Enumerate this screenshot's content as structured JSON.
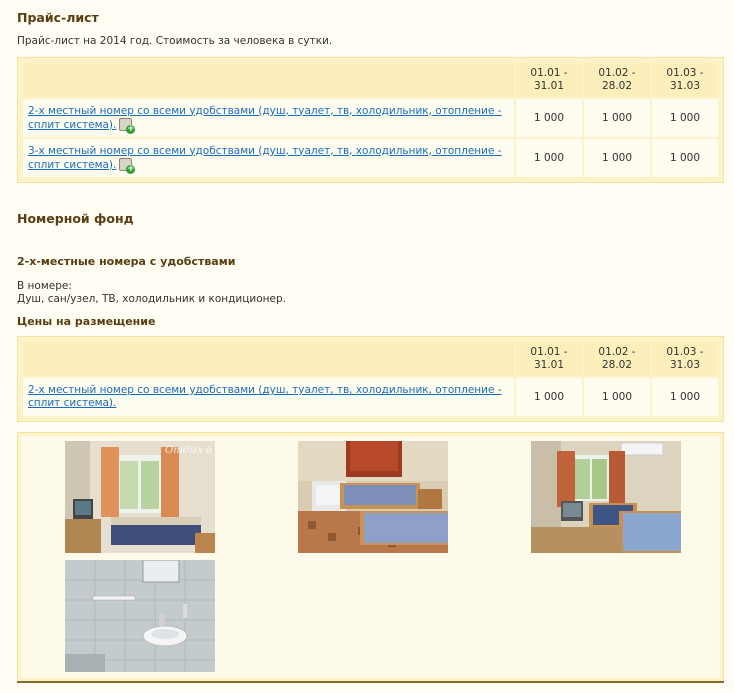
{
  "price_list": {
    "heading": "Прайс-лист",
    "note": "Прайс-лист на 2014 год. Стоимость за человека в сутки.",
    "columns": [
      "01.01 - 31.01",
      "01.02 - 28.02",
      "01.03 - 31.03"
    ],
    "rows": [
      {
        "name": "2-х местный номер со всеми удобствами (душ, туалет, тв, холодильник, отопление - сплит система).",
        "prices": [
          "1 000",
          "1 000",
          "1 000"
        ]
      },
      {
        "name": "3-х местный номер со всеми удобствами (душ, туалет, тв, холодильник, отопление - сплит система).",
        "prices": [
          "1 000",
          "1 000",
          "1 000"
        ]
      }
    ]
  },
  "room_fund": {
    "heading": "Номерной фонд",
    "category_title": "2-х-местные номера с удобствами",
    "in_room_label": "В номере:",
    "amenities": "Душ, сан/узел, ТВ, холодильник и кондиционер.",
    "prices_heading": "Цены на размещение",
    "columns": [
      "01.01 - 31.01",
      "01.02 - 28.02",
      "01.03 - 31.03"
    ],
    "rows": [
      {
        "name": "2-х местный номер со всеми удобствами (душ, туалет, тв, холодильник, отопление - сплит система).",
        "prices": [
          "1 000",
          "1 000",
          "1 000"
        ]
      }
    ]
  },
  "gallery": {
    "watermark": "Отдых в Со"
  }
}
